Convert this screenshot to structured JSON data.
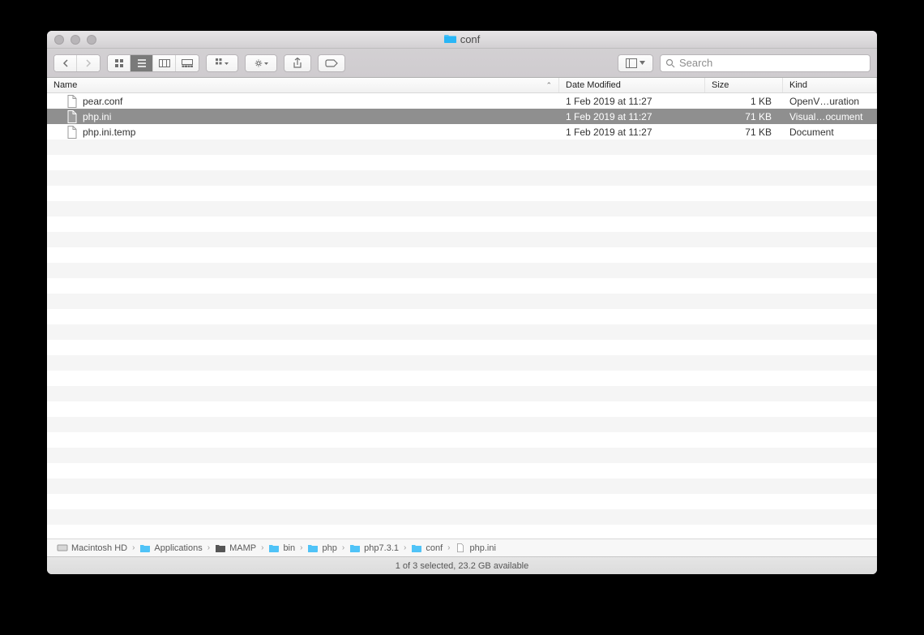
{
  "window": {
    "title": "conf"
  },
  "search": {
    "placeholder": "Search"
  },
  "columns": {
    "name": "Name",
    "date": "Date Modified",
    "size": "Size",
    "kind": "Kind"
  },
  "files": [
    {
      "name": "pear.conf",
      "date": "1 Feb 2019 at 11:27",
      "size": "1 KB",
      "kind": "OpenV…uration",
      "selected": false,
      "icon": "conf"
    },
    {
      "name": "php.ini",
      "date": "1 Feb 2019 at 11:27",
      "size": "71 KB",
      "kind": "Visual…ocument",
      "selected": true,
      "icon": "ini"
    },
    {
      "name": "php.ini.temp",
      "date": "1 Feb 2019 at 11:27",
      "size": "71 KB",
      "kind": "Document",
      "selected": false,
      "icon": "blank"
    }
  ],
  "path": [
    {
      "label": "Macintosh HD",
      "icon": "disk"
    },
    {
      "label": "Applications",
      "icon": "folder"
    },
    {
      "label": "MAMP",
      "icon": "folder-dark"
    },
    {
      "label": "bin",
      "icon": "folder"
    },
    {
      "label": "php",
      "icon": "folder"
    },
    {
      "label": "php7.3.1",
      "icon": "folder"
    },
    {
      "label": "conf",
      "icon": "folder"
    },
    {
      "label": "php.ini",
      "icon": "file"
    }
  ],
  "status": "1 of 3 selected, 23.2 GB available"
}
